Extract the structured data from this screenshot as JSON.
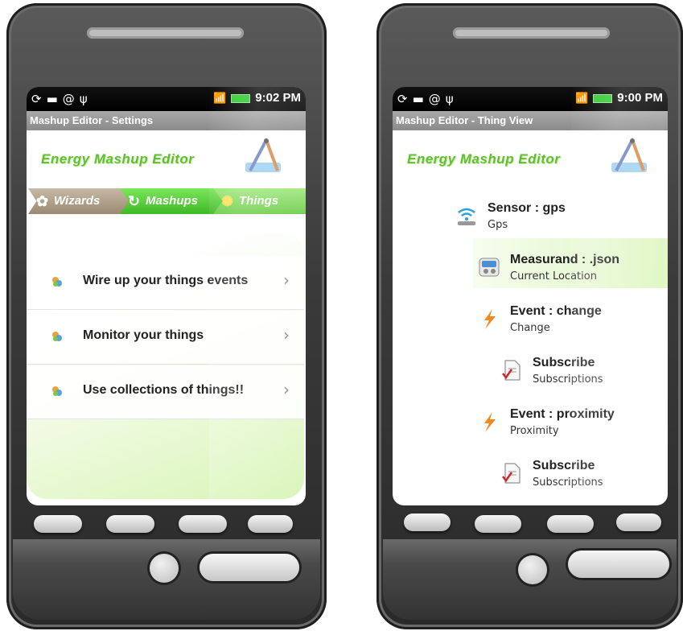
{
  "left_phone": {
    "status_time": "9:02 PM",
    "title": "Mashup Editor - Settings",
    "brand": "Energy Mashup Editor",
    "tabs": [
      "Wizards",
      "Mashups",
      "Things"
    ],
    "menu": [
      {
        "label": "Wire up your things events",
        "chevron": "›"
      },
      {
        "label": "Monitor your things",
        "chevron": "›"
      },
      {
        "label": "Use collections of things!!",
        "chevron": "›"
      }
    ]
  },
  "right_phone": {
    "status_time": "9:00 PM",
    "title": "Mashup Editor - Thing View",
    "brand": "Energy Mashup Editor",
    "tree": [
      {
        "title": "Sensor : gps",
        "subtitle": "Gps",
        "icon": "wifi-sensor-icon"
      },
      {
        "title": "Measurand : .json",
        "subtitle": "Current Location",
        "icon": "meter-icon"
      },
      {
        "title": "Event : change",
        "subtitle": "Change",
        "icon": "lightning-icon"
      },
      {
        "title": "Subscribe",
        "subtitle": "Subscriptions",
        "icon": "document-check-icon"
      },
      {
        "title": "Event : proximity",
        "subtitle": "Proximity",
        "icon": "lightning-icon"
      },
      {
        "title": "Subscribe",
        "subtitle": "Subscriptions",
        "icon": "document-check-icon"
      }
    ]
  },
  "colors": {
    "brand_green": "#5fbf2f",
    "title_bar": "#9a9a9a",
    "highlight": "#def6c0"
  }
}
